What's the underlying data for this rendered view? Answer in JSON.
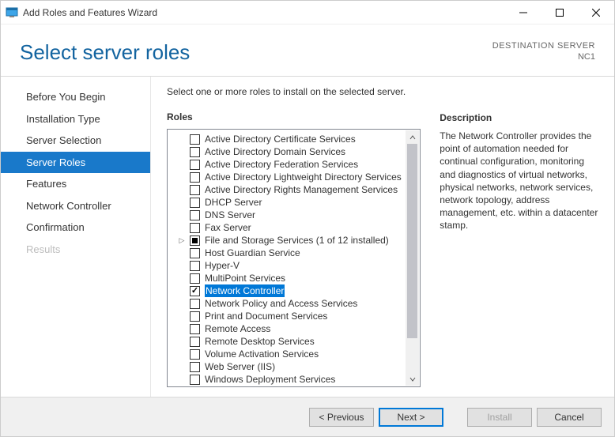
{
  "titlebar": {
    "title": "Add Roles and Features Wizard"
  },
  "header": {
    "title": "Select server roles",
    "destination_label": "DESTINATION SERVER",
    "destination_value": "NC1"
  },
  "sidebar": {
    "steps": [
      {
        "label": "Before You Begin",
        "active": false,
        "disabled": false
      },
      {
        "label": "Installation Type",
        "active": false,
        "disabled": false
      },
      {
        "label": "Server Selection",
        "active": false,
        "disabled": false
      },
      {
        "label": "Server Roles",
        "active": true,
        "disabled": false
      },
      {
        "label": "Features",
        "active": false,
        "disabled": false
      },
      {
        "label": "Network Controller",
        "active": false,
        "disabled": false
      },
      {
        "label": "Confirmation",
        "active": false,
        "disabled": false
      },
      {
        "label": "Results",
        "active": false,
        "disabled": true
      }
    ]
  },
  "main": {
    "instruction": "Select one or more roles to install on the selected server.",
    "roles_label": "Roles",
    "description_label": "Description",
    "description_text": "The Network Controller provides the point of automation needed for continual configuration, monitoring and diagnostics of virtual networks, physical networks, network services, network topology, address management, etc. within a datacenter stamp.",
    "roles": [
      {
        "label": "Active Directory Certificate Services",
        "state": "unchecked",
        "selected": false,
        "expandable": false
      },
      {
        "label": "Active Directory Domain Services",
        "state": "unchecked",
        "selected": false,
        "expandable": false
      },
      {
        "label": "Active Directory Federation Services",
        "state": "unchecked",
        "selected": false,
        "expandable": false
      },
      {
        "label": "Active Directory Lightweight Directory Services",
        "state": "unchecked",
        "selected": false,
        "expandable": false
      },
      {
        "label": "Active Directory Rights Management Services",
        "state": "unchecked",
        "selected": false,
        "expandable": false
      },
      {
        "label": "DHCP Server",
        "state": "unchecked",
        "selected": false,
        "expandable": false
      },
      {
        "label": "DNS Server",
        "state": "unchecked",
        "selected": false,
        "expandable": false
      },
      {
        "label": "Fax Server",
        "state": "unchecked",
        "selected": false,
        "expandable": false
      },
      {
        "label": "File and Storage Services (1 of 12 installed)",
        "state": "partial",
        "selected": false,
        "expandable": true
      },
      {
        "label": "Host Guardian Service",
        "state": "unchecked",
        "selected": false,
        "expandable": false
      },
      {
        "label": "Hyper-V",
        "state": "unchecked",
        "selected": false,
        "expandable": false
      },
      {
        "label": "MultiPoint Services",
        "state": "unchecked",
        "selected": false,
        "expandable": false
      },
      {
        "label": "Network Controller",
        "state": "checked",
        "selected": true,
        "expandable": false
      },
      {
        "label": "Network Policy and Access Services",
        "state": "unchecked",
        "selected": false,
        "expandable": false
      },
      {
        "label": "Print and Document Services",
        "state": "unchecked",
        "selected": false,
        "expandable": false
      },
      {
        "label": "Remote Access",
        "state": "unchecked",
        "selected": false,
        "expandable": false
      },
      {
        "label": "Remote Desktop Services",
        "state": "unchecked",
        "selected": false,
        "expandable": false
      },
      {
        "label": "Volume Activation Services",
        "state": "unchecked",
        "selected": false,
        "expandable": false
      },
      {
        "label": "Web Server (IIS)",
        "state": "unchecked",
        "selected": false,
        "expandable": false
      },
      {
        "label": "Windows Deployment Services",
        "state": "unchecked",
        "selected": false,
        "expandable": false
      }
    ]
  },
  "footer": {
    "previous": "< Previous",
    "next": "Next >",
    "install": "Install",
    "cancel": "Cancel"
  }
}
